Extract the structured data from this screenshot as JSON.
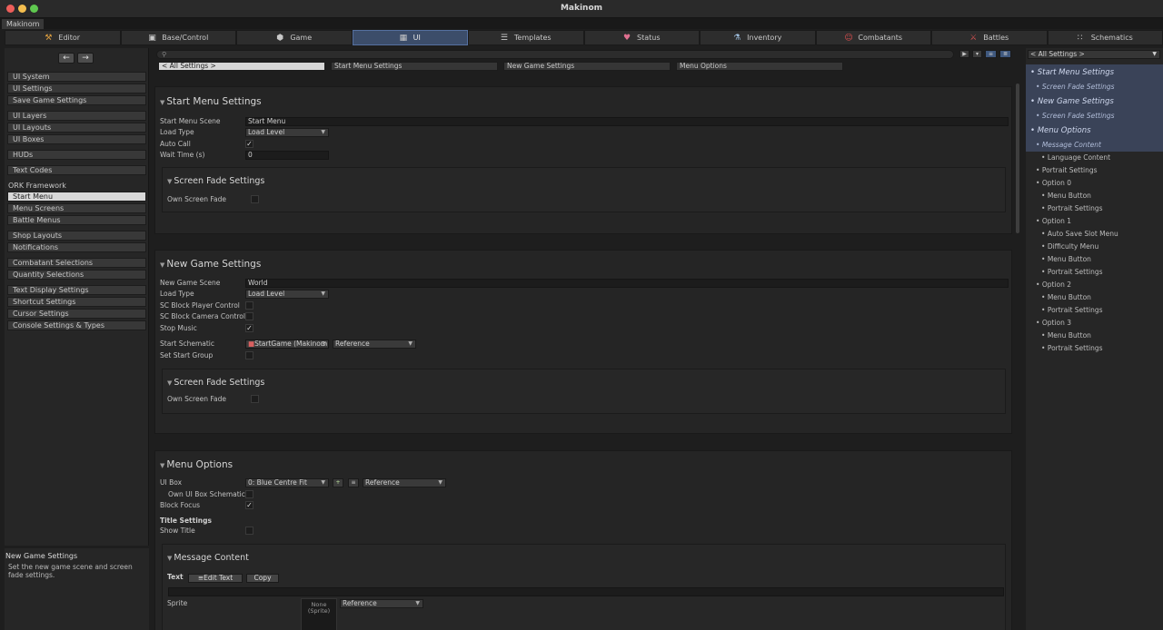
{
  "window": {
    "title": "Makinom",
    "doc_tab": "Makinom"
  },
  "top_tabs": [
    {
      "label": "Editor",
      "icon": "tools-icon",
      "active": false
    },
    {
      "label": "Base/Control",
      "icon": "gamepad-icon",
      "active": false
    },
    {
      "label": "Game",
      "icon": "cube-icon",
      "active": false
    },
    {
      "label": "UI",
      "icon": "ui-icon",
      "active": true
    },
    {
      "label": "Templates",
      "icon": "document-icon",
      "active": false
    },
    {
      "label": "Status",
      "icon": "heart-icon",
      "active": false
    },
    {
      "label": "Inventory",
      "icon": "potion-icon",
      "active": false
    },
    {
      "label": "Combatants",
      "icon": "combatant-icon",
      "active": false
    },
    {
      "label": "Battles",
      "icon": "swords-icon",
      "active": false
    },
    {
      "label": "Schematics",
      "icon": "nodes-icon",
      "active": false
    }
  ],
  "sidebar": {
    "groups": [
      [
        "UI System",
        "UI Settings",
        "Save Game Settings"
      ],
      [
        "UI Layers",
        "UI Layouts",
        "UI Boxes"
      ],
      [
        "HUDs"
      ],
      [
        "Text Codes"
      ]
    ],
    "ork_header": "ORK Framework",
    "ork_groups": [
      [
        "Start Menu",
        "Menu Screens",
        "Battle Menus"
      ],
      [
        "Shop Layouts",
        "Notifications"
      ],
      [
        "Combatant Selections",
        "Quantity Selections"
      ],
      [
        "Text Display Settings",
        "Shortcut Settings",
        "Cursor Settings",
        "Console Settings & Types"
      ]
    ],
    "active_item": "Start Menu"
  },
  "help": {
    "title": "New Game Settings",
    "text": "Set the new game scene and screen fade settings."
  },
  "search": {
    "placeholder": ""
  },
  "breadcrumbs": [
    "< All Settings >",
    "Start Menu Settings",
    "New Game Settings",
    "Menu Options"
  ],
  "start_menu": {
    "title": "Start Menu Settings",
    "scene_label": "Start Menu Scene",
    "scene_value": "Start Menu",
    "load_type_label": "Load Type",
    "load_type_value": "Load Level",
    "auto_call_label": "Auto Call",
    "auto_call": true,
    "wait_label": "Wait Time (s)",
    "wait_value": "0",
    "fade_title": "Screen Fade Settings",
    "own_fade_label": "Own Screen Fade",
    "own_fade": false
  },
  "new_game": {
    "title": "New Game Settings",
    "scene_label": "New Game Scene",
    "scene_value": "World",
    "load_type_label": "Load Type",
    "load_type_value": "Load Level",
    "block_player_label": "SC Block Player Control",
    "block_player": false,
    "block_camera_label": "SC Block Camera Control",
    "block_camera": false,
    "stop_music_label": "Stop Music",
    "stop_music": true,
    "schematic_label": "Start Schematic",
    "schematic_value": "StartGame (Makinom",
    "schematic_ref": "Reference",
    "start_group_label": "Set Start Group",
    "start_group": false,
    "fade_title": "Screen Fade Settings",
    "own_fade_label": "Own Screen Fade",
    "own_fade": false
  },
  "menu_options": {
    "title": "Menu Options",
    "ui_box_label": "UI Box",
    "ui_box_value": "0: Blue Centre Fit",
    "ui_box_ref": "Reference",
    "own_schematics_label": "Own UI Box Schematics",
    "block_focus_label": "Block Focus",
    "block_focus": true,
    "title_settings_label": "Title Settings",
    "show_title_label": "Show Title",
    "show_title": false,
    "message_title": "Message Content",
    "text_label": "Text",
    "edit_text_label": "Edit Text",
    "copy_label": "Copy",
    "sprite_label": "Sprite",
    "sprite_value": "None\n(Sprite)",
    "sprite_ref": "Reference"
  },
  "outline": {
    "dropdown": "< All Settings >",
    "items": [
      {
        "label": "Start Menu Settings",
        "level": 0,
        "style": "big"
      },
      {
        "label": "Screen Fade Settings",
        "level": 1,
        "style": "ital"
      },
      {
        "label": "New Game Settings",
        "level": 0,
        "style": "big"
      },
      {
        "label": "Screen Fade Settings",
        "level": 1,
        "style": "ital"
      },
      {
        "label": "Menu Options",
        "level": 0,
        "style": "big"
      },
      {
        "label": "Message Content",
        "level": 1,
        "style": "ital"
      },
      {
        "label": "Language Content",
        "level": 2,
        "style": ""
      },
      {
        "label": "Portrait Settings",
        "level": 1,
        "style": ""
      },
      {
        "label": "Option 0",
        "level": 1,
        "style": ""
      },
      {
        "label": "Menu Button",
        "level": 2,
        "style": ""
      },
      {
        "label": "Portrait Settings",
        "level": 2,
        "style": ""
      },
      {
        "label": "Option 1",
        "level": 1,
        "style": ""
      },
      {
        "label": "Auto Save Slot Menu",
        "level": 2,
        "style": ""
      },
      {
        "label": "Difficulty Menu",
        "level": 2,
        "style": ""
      },
      {
        "label": "Menu Button",
        "level": 2,
        "style": ""
      },
      {
        "label": "Portrait Settings",
        "level": 2,
        "style": ""
      },
      {
        "label": "Option 2",
        "level": 1,
        "style": ""
      },
      {
        "label": "Menu Button",
        "level": 2,
        "style": ""
      },
      {
        "label": "Portrait Settings",
        "level": 2,
        "style": ""
      },
      {
        "label": "Option 3",
        "level": 1,
        "style": ""
      },
      {
        "label": "Menu Button",
        "level": 2,
        "style": ""
      },
      {
        "label": "Portrait Settings",
        "level": 2,
        "style": ""
      }
    ]
  },
  "colors": {
    "accent": "#3c4d6a",
    "active_item_bg": "#d8d8d8",
    "outline_highlight": "#3a4358"
  }
}
